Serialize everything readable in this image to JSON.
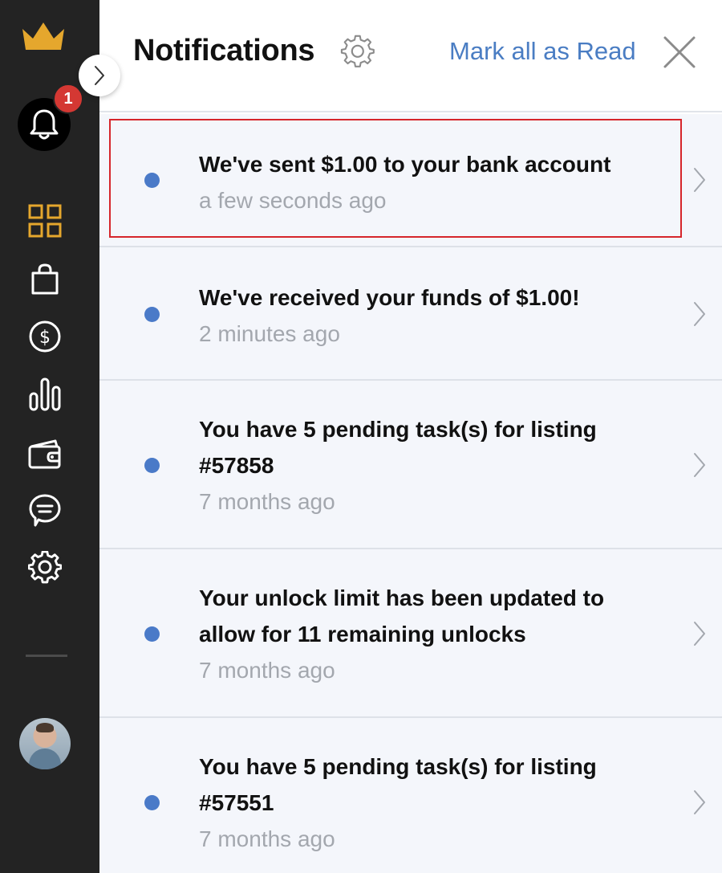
{
  "header": {
    "title": "Notifications",
    "mark_all_label": "Mark all as Read"
  },
  "sidebar": {
    "notification_count": "1",
    "items": [
      {
        "icon": "dashboard-icon"
      },
      {
        "icon": "shopping-bag-icon"
      },
      {
        "icon": "dollar-icon"
      },
      {
        "icon": "bar-chart-icon"
      },
      {
        "icon": "wallet-icon"
      },
      {
        "icon": "chat-icon"
      },
      {
        "icon": "gear-icon"
      }
    ]
  },
  "notifications": [
    {
      "message": "We've sent $1.00 to your bank account",
      "time": "a few seconds ago",
      "unread": true
    },
    {
      "message": "We've received your funds of $1.00!",
      "time": "2 minutes ago",
      "unread": true
    },
    {
      "message": "You have 5 pending task(s) for listing #57858",
      "time": "7 months ago",
      "unread": true
    },
    {
      "message": "Your unlock limit has been updated to allow for 11 remaining unlocks",
      "time": "7 months ago",
      "unread": true
    },
    {
      "message": "You have 5 pending task(s) for listing #57551",
      "time": "7 months ago",
      "unread": true
    }
  ],
  "colors": {
    "sidebar_bg": "#232323",
    "accent_gold": "#e5a72d",
    "link_blue": "#4a7dc3",
    "unread_dot": "#4a7ac8",
    "badge_red": "#d43833",
    "highlight_red": "#d6262b"
  }
}
